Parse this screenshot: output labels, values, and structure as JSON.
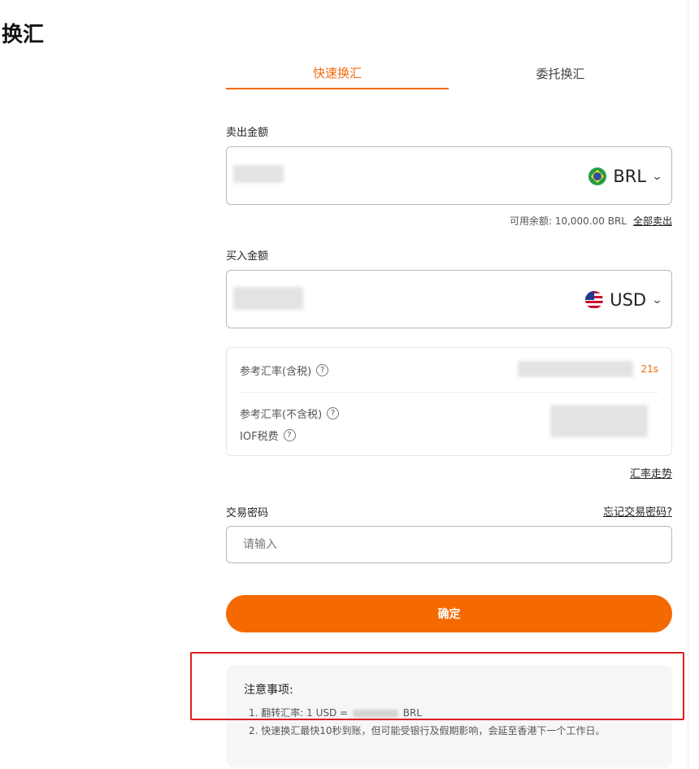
{
  "page": {
    "title": "换汇"
  },
  "tabs": [
    {
      "label": "快速换汇",
      "active": true
    },
    {
      "label": "委托换汇",
      "active": false
    }
  ],
  "sell": {
    "label": "卖出金额",
    "currency": "BRL",
    "flag_icon": "brazil-flag-icon",
    "balance_text": "可用余额: 10,000.00 BRL",
    "sell_all_label": "全部卖出"
  },
  "buy": {
    "label": "买入金额",
    "currency": "USD",
    "flag_icon": "us-flag-icon"
  },
  "rates": {
    "ref_rate_tax_label": "参考汇率(含税)",
    "countdown": "21s",
    "ref_rate_notax_label": "参考汇率(不含税)",
    "iof_label": "IOF税费",
    "trend_link": "汇率走势"
  },
  "password": {
    "label": "交易密码",
    "forgot_link": "忘记交易密码?",
    "placeholder": "请输入"
  },
  "confirm": {
    "label": "确定"
  },
  "notes": {
    "title": "注意事项:",
    "item1_prefix": "1. 翻转汇率: 1 USD =",
    "item1_suffix": "BRL",
    "item2": "2. 快速换汇最快10秒到账，但可能受银行及假期影响，会延至香港下一个工作日。"
  },
  "colors": {
    "accent": "#f26a0e",
    "button": "#f56a00",
    "highlight": "#e02020"
  }
}
